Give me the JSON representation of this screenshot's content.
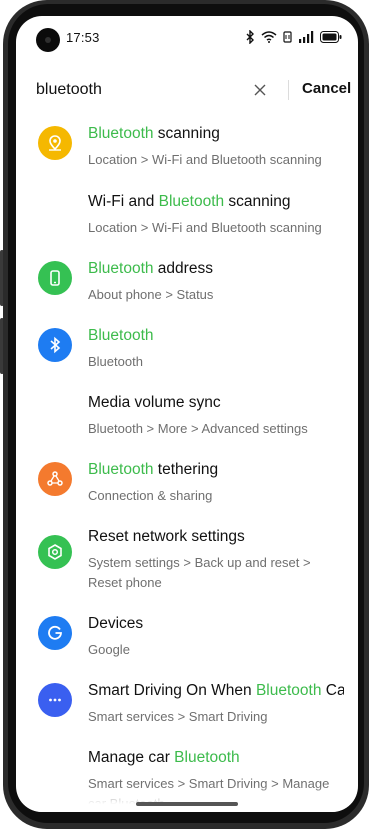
{
  "status_bar": {
    "time": "17:53",
    "icons": [
      "bluetooth-icon",
      "wifi-icon",
      "nfc-icon",
      "signal-icon",
      "battery-icon"
    ]
  },
  "search": {
    "query": "bluetooth",
    "cancel_label": "Cancel"
  },
  "results": [
    {
      "title_pre": "",
      "title_hl": "Bluetooth",
      "title_post": " scanning",
      "subtitle": "Location > Wi-Fi and Bluetooth scanning",
      "icon": "location-icon",
      "icon_color": "#f5b800"
    },
    {
      "title_pre": "Wi-Fi and ",
      "title_hl": "Bluetooth",
      "title_post": " scanning",
      "subtitle": "Location > Wi-Fi and Bluetooth scanning",
      "icon": "",
      "icon_color": ""
    },
    {
      "title_pre": "",
      "title_hl": "Bluetooth",
      "title_post": " address",
      "subtitle": "About phone > Status",
      "icon": "phone-icon",
      "icon_color": "#35c153"
    },
    {
      "title_pre": "",
      "title_hl": "Bluetooth",
      "title_post": "",
      "subtitle": "Bluetooth",
      "icon": "bluetooth-icon",
      "icon_color": "#1e7cf2"
    },
    {
      "title_pre": "Media volume sync",
      "title_hl": "",
      "title_post": "",
      "subtitle": "Bluetooth > More > Advanced settings",
      "icon": "",
      "icon_color": ""
    },
    {
      "title_pre": "",
      "title_hl": "Bluetooth",
      "title_post": " tethering",
      "subtitle": "Connection & sharing",
      "icon": "hotspot-icon",
      "icon_color": "#f47a2e"
    },
    {
      "title_pre": "Reset network settings",
      "title_hl": "",
      "title_post": "",
      "subtitle": "System settings > Back up and reset > Reset phone",
      "icon": "hexagon-gear-icon",
      "icon_color": "#35c153"
    },
    {
      "title_pre": "Devices",
      "title_hl": "",
      "title_post": "",
      "subtitle": "Google",
      "icon": "google-icon",
      "icon_color": "#1e7cf2"
    },
    {
      "title_pre": "Smart Driving On When ",
      "title_hl": "Bluetooth",
      "title_post": " Ca..",
      "subtitle": "Smart services > Smart Driving",
      "icon": "more-dots-icon",
      "icon_color": "#3a5ff0"
    },
    {
      "title_pre": "Manage car ",
      "title_hl": "Bluetooth",
      "title_post": "",
      "subtitle": "Smart services > Smart Driving > Manage car Bluetooth",
      "icon": "",
      "icon_color": ""
    }
  ]
}
